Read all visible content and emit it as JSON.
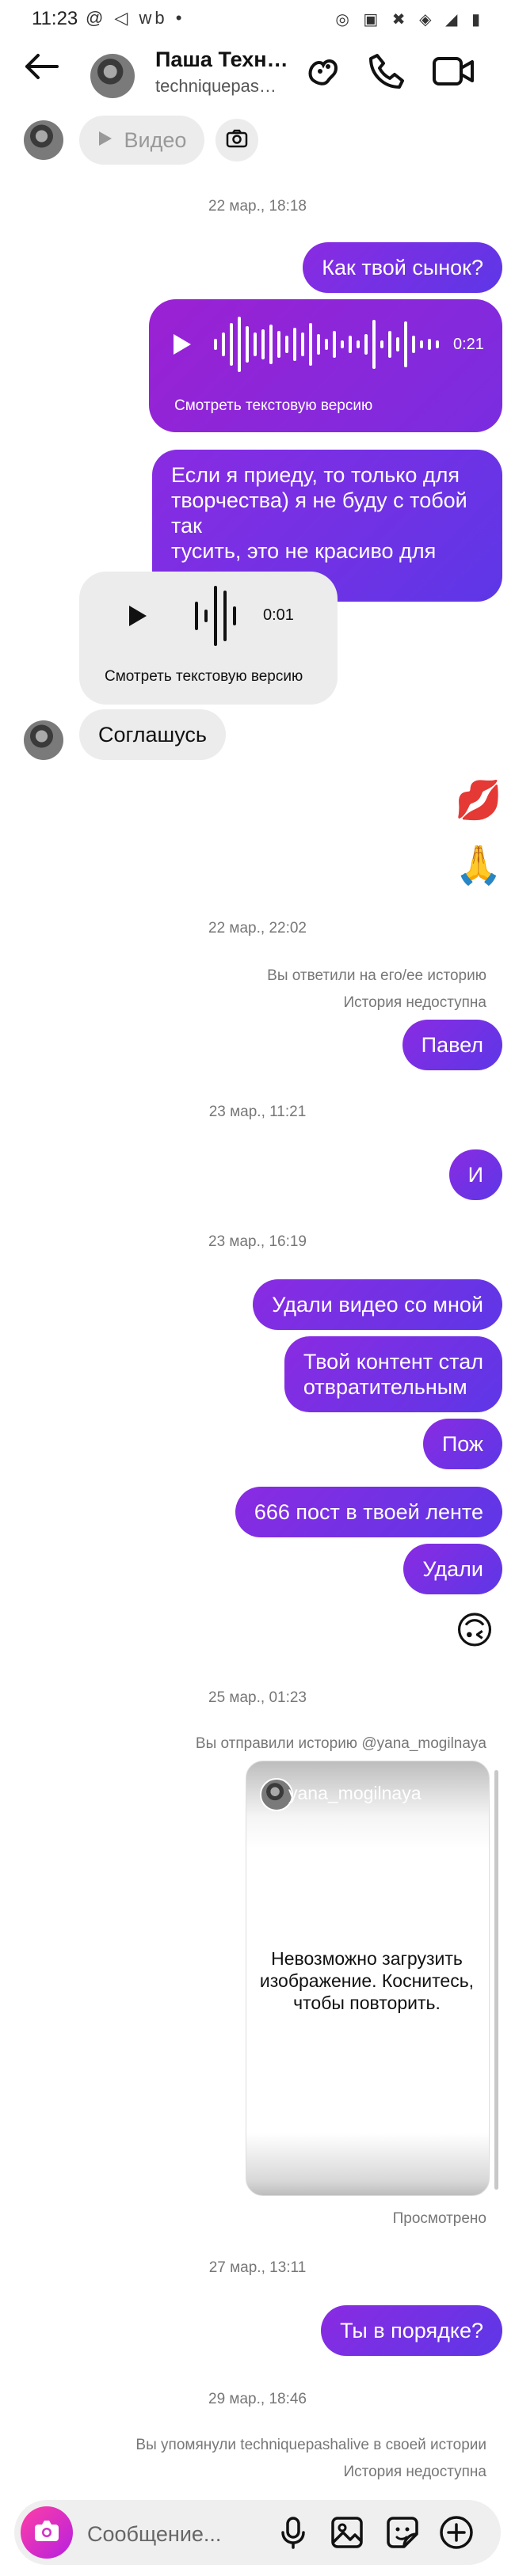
{
  "status_bar": {
    "time": "11:23",
    "left_icons": "@ ◁ wb •",
    "right_icons": "◎ ▣ ✖ ◈ ◢ ▮"
  },
  "header": {
    "name": "Паша Техн…",
    "username": "techniquepas…"
  },
  "video_pill": {
    "label": "Видео"
  },
  "messages": {
    "date1": "22 мар., 18:18",
    "m1": "Как твой сынок?",
    "voice_out_duration": "0:21",
    "voice_out_link": "Смотреть текстовую версию",
    "m2": "Если я приеду, то только для\nтворчества) я не буду с тобой так\nтусить, это не красиво для меня",
    "voice_in_duration": "0:01",
    "voice_in_link": "Смотреть текстовую версию",
    "m3": "Соглашусь",
    "emoji1": "💋",
    "emoji2": "🙏",
    "date2": "22 мар., 22:02",
    "note1": "Вы ответили на его/ее историю",
    "note2": "История недоступна",
    "m4": "Павел",
    "date3": "23 мар., 11:21",
    "m5": "И",
    "date4": "23 мар., 16:19",
    "m6": "Удали видео со мной",
    "m7": "Твой контент стал\nотвратительным",
    "m8": "Пож",
    "m9": "666 пост в твоей ленте",
    "m10": "Удали",
    "emoji3": "🙃",
    "date5": "25 мар., 01:23",
    "note3": "Вы отправили историю @yana_mogilnaya",
    "story_user": "yana_mogilnaya",
    "story_error": "Невозможно загрузить\nизображение. Коснитесь,\nчтобы повторить.",
    "seen": "Просмотрено",
    "date6": "27 мар., 13:11",
    "m11": "Ты в порядке?",
    "date7": "29 мар., 18:46",
    "note4": "Вы упомянули techniquepashalive в своей истории",
    "note5": "История недоступна"
  },
  "composer": {
    "placeholder": "Сообщение..."
  },
  "colors": {
    "accent_purple": "#8a2be2",
    "accent_blue": "#5d37e6"
  }
}
